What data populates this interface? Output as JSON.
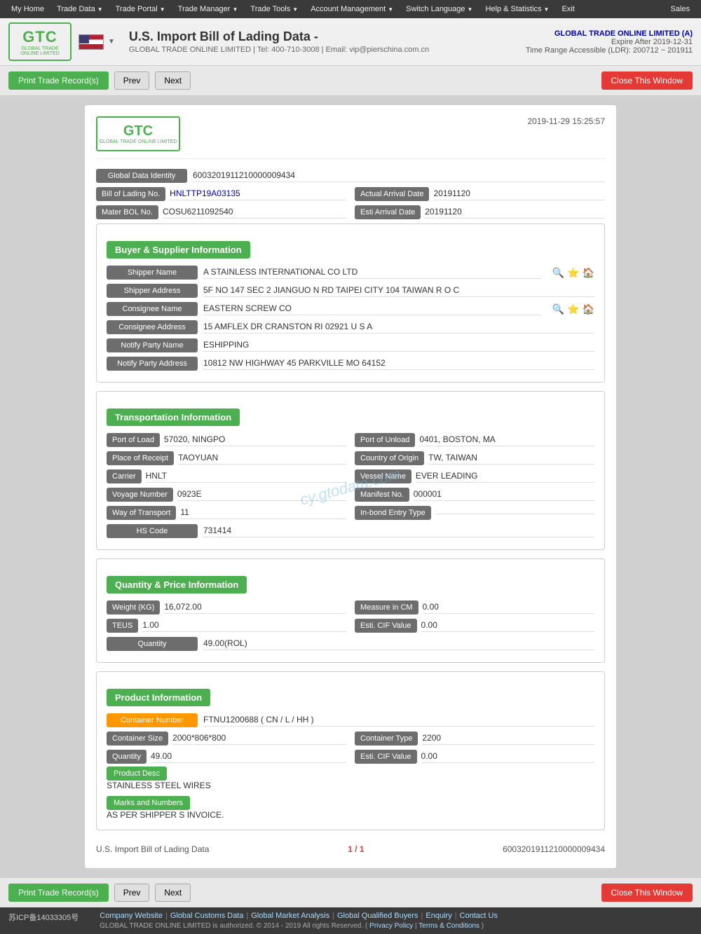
{
  "topnav": {
    "items": [
      {
        "label": "My Home",
        "has_arrow": true
      },
      {
        "label": "Trade Data",
        "has_arrow": true
      },
      {
        "label": "Trade Portal",
        "has_arrow": true
      },
      {
        "label": "Trade Manager",
        "has_arrow": true
      },
      {
        "label": "Trade Tools",
        "has_arrow": true
      },
      {
        "label": "Account Management",
        "has_arrow": true
      },
      {
        "label": "Switch Language",
        "has_arrow": true
      },
      {
        "label": "Help & Statistics",
        "has_arrow": true
      },
      {
        "label": "Exit",
        "has_arrow": false
      }
    ],
    "sales": "Sales"
  },
  "header": {
    "logo_text": "GTC",
    "logo_sub": "GLOBAL TRADE ONLINE LIMITED",
    "page_title": "U.S. Import Bill of Lading Data  -",
    "company": "GLOBAL TRADE ONLINE LIMITED",
    "tel": "Tel: 400-710-3008",
    "email": "Email: vip@pierschina.com.cn",
    "account_name": "GLOBAL TRADE ONLINE LIMITED (A)",
    "expire": "Expire After 2019-12-31",
    "ldr": "Time Range Accessible (LDR): 200712 ~ 201911"
  },
  "toolbar": {
    "print_label": "Print Trade Record(s)",
    "prev_label": "Prev",
    "next_label": "Next",
    "close_label": "Close This Window"
  },
  "record": {
    "timestamp": "2019-11-29 15:25:57",
    "logo_text": "GTC",
    "logo_sub": "GLOBAL TRADE ONLINE LIMITED",
    "global_data_identity_label": "Global Data Identity",
    "global_data_identity_value": "6003201911210000009434",
    "bill_of_lading_label": "Bill of Lading No.",
    "bill_of_lading_value": "HNLTTP19A03135",
    "actual_arrival_label": "Actual Arrival Date",
    "actual_arrival_value": "20191120",
    "mater_bol_label": "Mater BOL No.",
    "mater_bol_value": "COSU6211092540",
    "esti_arrival_label": "Esti Arrival Date",
    "esti_arrival_value": "20191120",
    "buyer_supplier_title": "Buyer & Supplier Information",
    "shipper_name_label": "Shipper Name",
    "shipper_name_value": "A STAINLESS INTERNATIONAL CO LTD",
    "shipper_address_label": "Shipper Address",
    "shipper_address_value": "5F NO 147 SEC 2 JIANGUO N RD TAIPEI CITY 104 TAIWAN R O C",
    "consignee_name_label": "Consignee Name",
    "consignee_name_value": "EASTERN SCREW CO",
    "consignee_address_label": "Consignee Address",
    "consignee_address_value": "15 AMFLEX DR CRANSTON RI 02921 U S A",
    "notify_party_name_label": "Notify Party Name",
    "notify_party_name_value": "ESHIPPING",
    "notify_party_address_label": "Notify Party Address",
    "notify_party_address_value": "10812 NW HIGHWAY 45 PARKVILLE MO 64152",
    "transportation_title": "Transportation Information",
    "port_of_load_label": "Port of Load",
    "port_of_load_value": "57020, NINGPO",
    "port_of_unload_label": "Port of Unload",
    "port_of_unload_value": "0401, BOSTON, MA",
    "place_of_receipt_label": "Place of Receipt",
    "place_of_receipt_value": "TAOYUAN",
    "country_of_origin_label": "Country of Origin",
    "country_of_origin_value": "TW, TAIWAN",
    "carrier_label": "Carrier",
    "carrier_value": "HNLT",
    "vessel_name_label": "Vessel Name",
    "vessel_name_value": "EVER LEADING",
    "voyage_number_label": "Voyage Number",
    "voyage_number_value": "0923E",
    "manifest_no_label": "Manifest No.",
    "manifest_no_value": "000001",
    "way_of_transport_label": "Way of Transport",
    "way_of_transport_value": "11",
    "in_bond_entry_label": "In-bond Entry Type",
    "in_bond_entry_value": "",
    "hs_code_label": "HS Code",
    "hs_code_value": "731414",
    "quantity_price_title": "Quantity & Price Information",
    "weight_label": "Weight (KG)",
    "weight_value": "16,072.00",
    "measure_cm_label": "Measure in CM",
    "measure_cm_value": "0.00",
    "teus_label": "TEUS",
    "teus_value": "1.00",
    "esti_cif_label": "Esti. CIF Value",
    "esti_cif_value": "0.00",
    "quantity_label": "Quantity",
    "quantity_value": "49.00(ROL)",
    "product_info_title": "Product Information",
    "container_number_label": "Container Number",
    "container_number_value": "FTNU1200688 ( CN / L / HH )",
    "container_size_label": "Container Size",
    "container_size_value": "2000*806*800",
    "container_type_label": "Container Type",
    "container_type_value": "2200",
    "quantity_prod_label": "Quantity",
    "quantity_prod_value": "49.00",
    "esti_cif_prod_label": "Esti. CIF Value",
    "esti_cif_prod_value": "0.00",
    "product_desc_label": "Product Desc",
    "product_desc_value": "STAINLESS STEEL WIRES",
    "marks_label": "Marks and Numbers",
    "marks_value": "AS PER SHIPPER S INVOICE.",
    "watermark": "cy.gtodata.com"
  },
  "pagination": {
    "left": "U.S. Import Bill of Lading Data",
    "center": "1 / 1",
    "right": "6003201911210000009434"
  },
  "footer": {
    "icp": "苏ICP备14033305号",
    "links": [
      {
        "label": "Company Website"
      },
      {
        "label": "Global Customs Data"
      },
      {
        "label": "Global Market Analysis"
      },
      {
        "label": "Global Qualified Buyers"
      },
      {
        "label": "Enquiry"
      },
      {
        "label": "Contact Us"
      }
    ],
    "copyright": "GLOBAL TRADE ONLINE LIMITED is authorized. © 2014 - 2019 All rights Reserved.",
    "privacy": "Privacy Policy",
    "terms": "Terms & Conditions"
  }
}
